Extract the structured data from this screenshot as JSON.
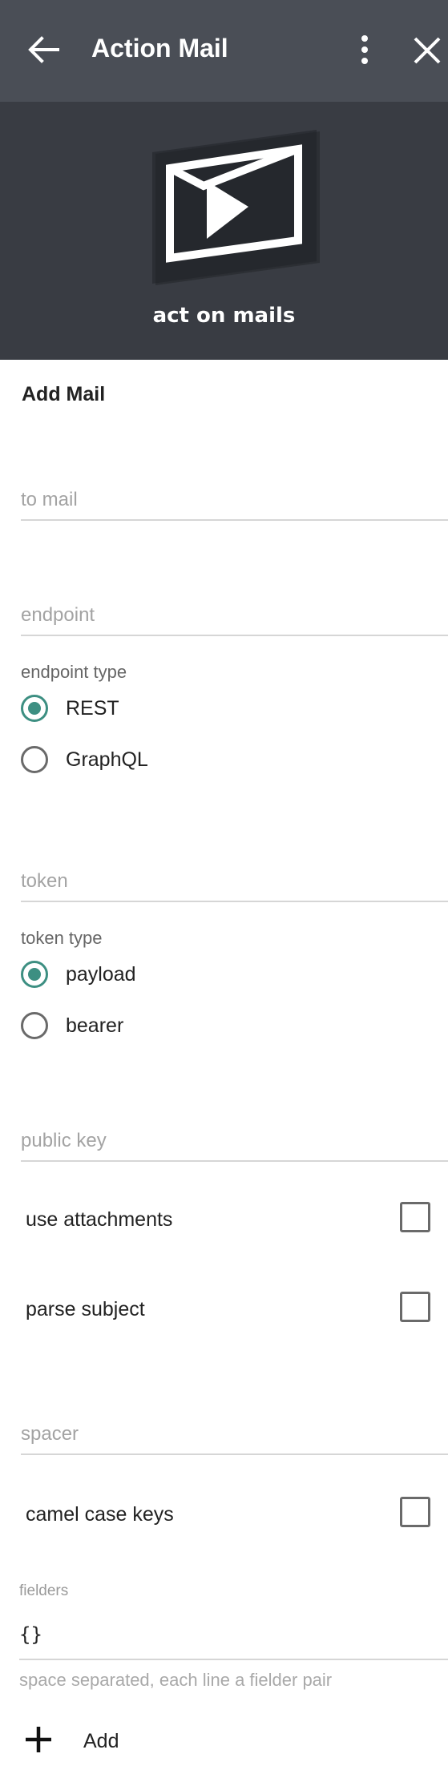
{
  "appbar": {
    "title": "Action Mail",
    "icons": [
      "arrow-back-icon",
      "more-vert-icon",
      "close-icon"
    ],
    "background": "#4a4e56"
  },
  "hero": {
    "tagline": "act on mails",
    "logo_icon": "mail-play-logo",
    "background": "#393c43"
  },
  "form": {
    "section_title": "Add Mail",
    "to_mail": {
      "placeholder": "to mail",
      "value": ""
    },
    "endpoint": {
      "placeholder": "endpoint",
      "value": ""
    },
    "endpoint_type": {
      "label": "endpoint type",
      "options": [
        "REST",
        "GraphQL"
      ],
      "selected": "REST"
    },
    "token": {
      "placeholder": "token",
      "value": ""
    },
    "token_type": {
      "label": "token type",
      "options": [
        "payload",
        "bearer"
      ],
      "selected": "payload"
    },
    "public_key": {
      "placeholder": "public key",
      "value": ""
    },
    "use_attachments": {
      "label": "use attachments",
      "checked": false
    },
    "parse_subject": {
      "label": "parse subject",
      "checked": false
    },
    "spacer": {
      "placeholder": "spacer",
      "value": ""
    },
    "camel_case_keys": {
      "label": "camel case keys",
      "checked": false
    },
    "fielders": {
      "label": "fielders",
      "value": "{}",
      "helper": "space separated, each line a fielder pair"
    },
    "add_button": {
      "label": "Add",
      "icon": "plus-icon"
    }
  },
  "colors": {
    "accent": "#3d8f82"
  }
}
